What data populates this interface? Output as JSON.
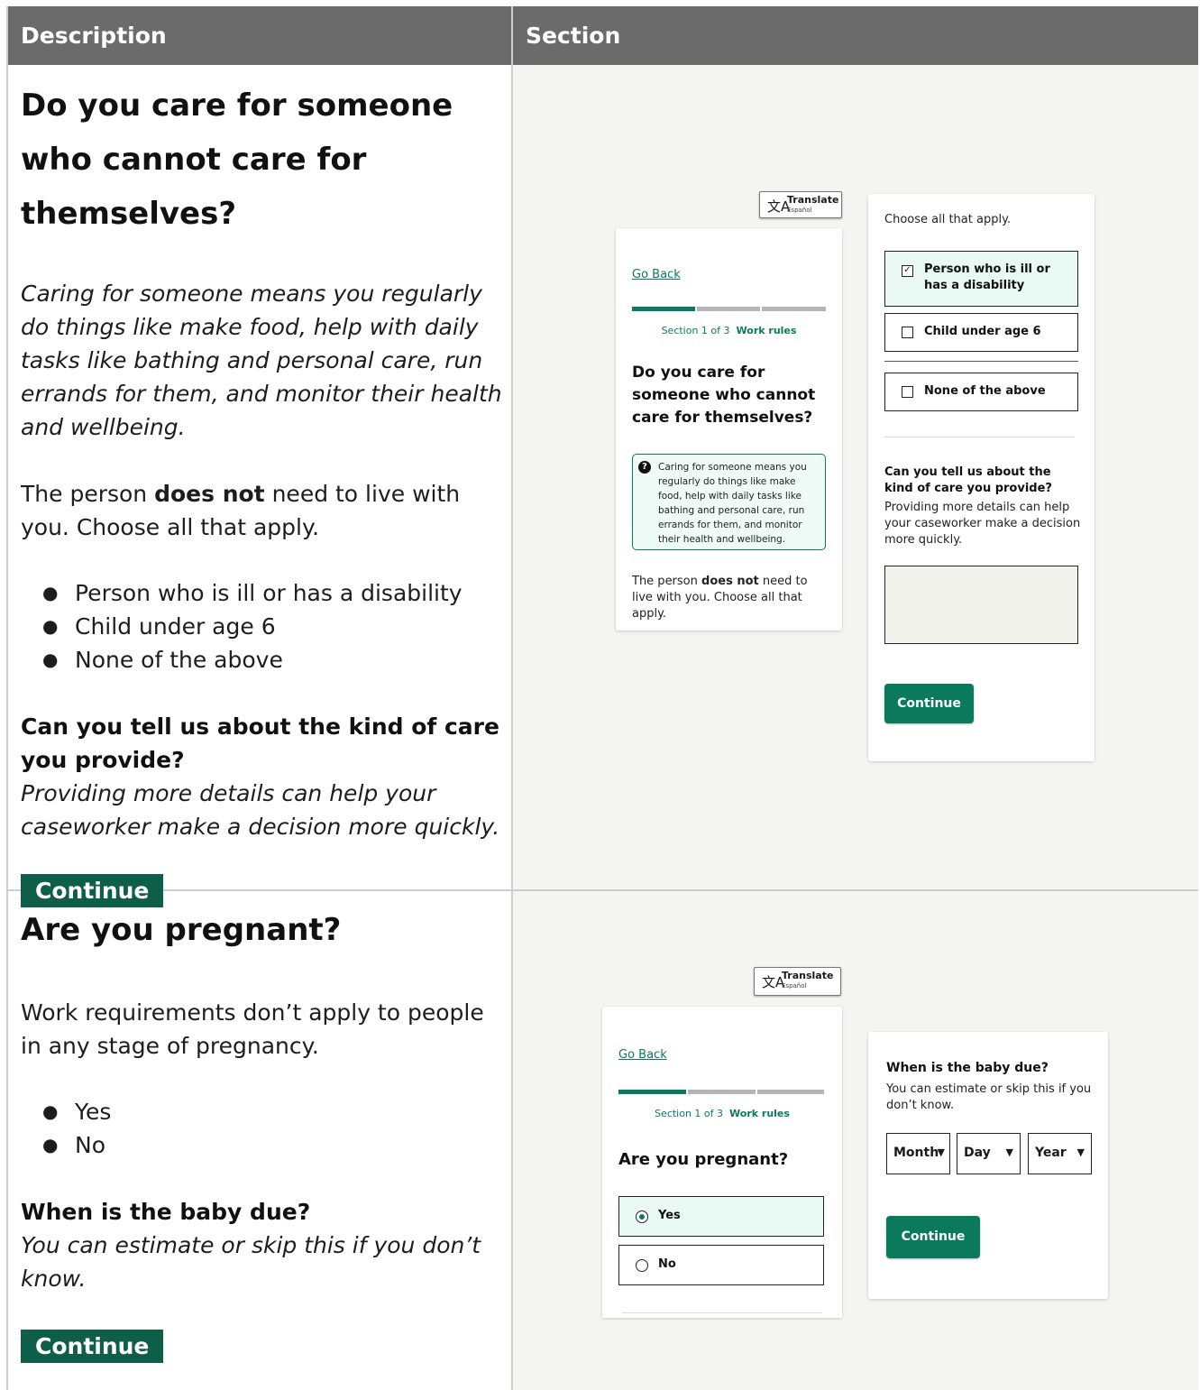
{
  "headers": {
    "description": "Description",
    "section": "Section"
  },
  "row1": {
    "desc": {
      "title": "Do you care for someone who cannot care for themselves?",
      "intro": "Caring for someone means you regularly do things like make food, help with daily tasks like bathing and personal care, run errands for them, and monitor their health and wellbeing.",
      "line_pre": "The person ",
      "line_bold": "does not",
      "line_post": " need to live with you. Choose all that apply.",
      "options": [
        "Person who is ill or has a disability",
        "Child under age 6",
        "None of the above"
      ],
      "followup_title": "Can you tell us about the kind of care you provide?",
      "followup_hint": "Providing more details can help your caseworker make a decision more quickly.",
      "button": "Continue"
    },
    "mock": {
      "translate": "Translate",
      "translate_sub": "Español",
      "go_back": "Go Back",
      "section_label": "Section 1 of 3",
      "section_name": "Work rules",
      "title": "Do you care for someone who cannot care for themselves?",
      "hint": "Caring for someone means you regularly do things like make food, help with daily tasks like bathing and personal care, run errands for them, and monitor their health and wellbeing.",
      "text_pre": "The person ",
      "text_bold": "does not",
      "text_post": " need to live with you. Choose all that apply.",
      "choose": "Choose all that apply.",
      "options": [
        {
          "label": "Person who is ill or has a disability",
          "checked": true
        },
        {
          "label": "Child under age 6",
          "checked": false
        },
        {
          "label": "None of the above",
          "checked": false
        }
      ],
      "check_mark": "✓",
      "question": "Can you tell us about the kind of care you provide?",
      "question_hint": "Providing more details can help your caseworker make a decision more quickly.",
      "button": "Continue"
    }
  },
  "row2": {
    "desc": {
      "title": "Are you pregnant?",
      "intro": "Work requirements don’t apply to people in any stage of pregnancy.",
      "options": [
        "Yes",
        "No"
      ],
      "followup_title": "When is the baby due?",
      "followup_hint": "You can estimate or skip this if you don’t know.",
      "button": "Continue"
    },
    "mock": {
      "translate": "Translate",
      "translate_sub": "Español",
      "go_back": "Go Back",
      "section_label": "Section 1 of 3",
      "section_name": "Work rules",
      "title": "Are you pregnant?",
      "options": [
        {
          "label": "Yes",
          "selected": true
        },
        {
          "label": "No",
          "selected": false
        }
      ],
      "due_title": "When is the baby due?",
      "due_hint": "You can estimate or skip this if you don’t know.",
      "selects": [
        "Month",
        "Day",
        "Year"
      ],
      "button": "Continue"
    }
  },
  "colors": {
    "brand": "#0b7a5c",
    "header_bg": "#6b6b6b",
    "desc_button": "#0f5e4a"
  },
  "icons": {
    "translate": "translate-icon",
    "help": "question-circle-icon",
    "arrow": "dropdown-arrow-icon"
  }
}
